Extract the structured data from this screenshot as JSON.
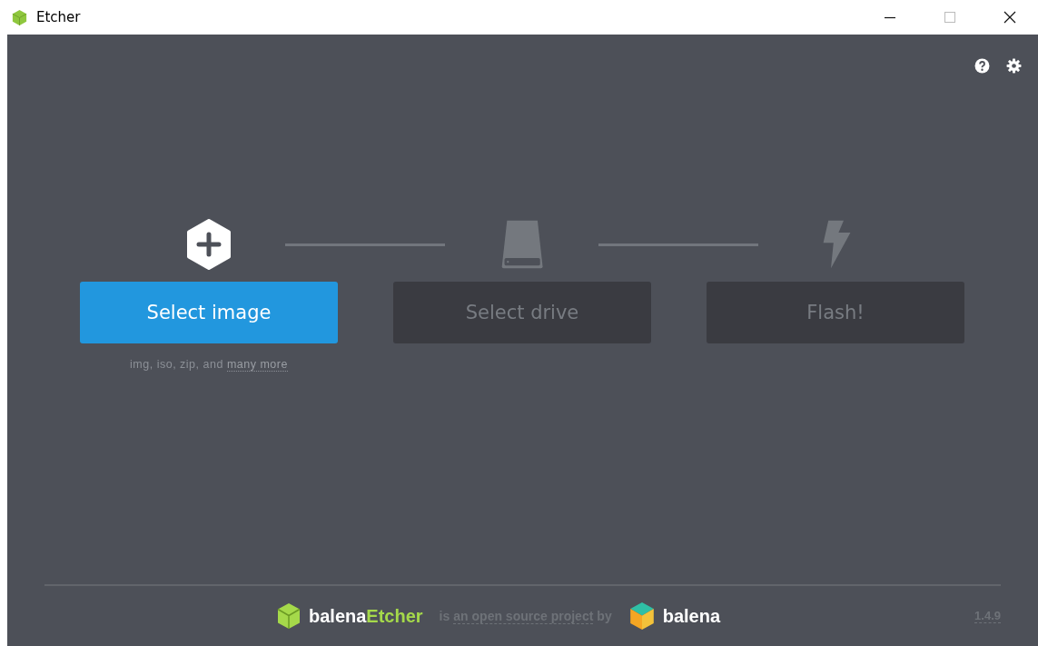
{
  "window": {
    "title": "Etcher"
  },
  "steps": [
    {
      "kind": "image",
      "label": "Select image",
      "disabled": false,
      "hint": "img, iso, zip, and",
      "hint_link": "many more"
    },
    {
      "kind": "drive",
      "label": "Select drive",
      "disabled": true
    },
    {
      "kind": "flash",
      "label": "Flash!",
      "disabled": true
    }
  ],
  "footer": {
    "brand_prefix": "balena",
    "brand_suffix": "Etcher",
    "text_before": "is",
    "link": "an open source project",
    "text_after": "by",
    "company": "balena",
    "version": "1.4.9"
  }
}
